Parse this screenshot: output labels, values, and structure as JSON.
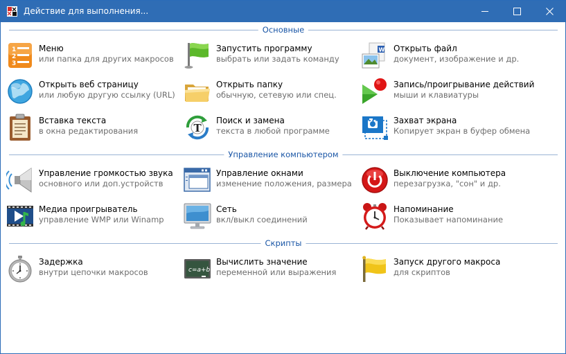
{
  "window": {
    "title": "Действие для выполнения..."
  },
  "colors": {
    "titlebar": "#2f6db5",
    "section_text": "#1a56a6",
    "section_line": "#9ab3d5",
    "subtitle_text": "#6d6d6d"
  },
  "sections": {
    "basic": {
      "label": "Основные",
      "items": [
        {
          "icon": "menu-list-icon",
          "title": "Меню",
          "subtitle": "или папка для других макросов"
        },
        {
          "icon": "green-flag-icon",
          "title": "Запустить программу",
          "subtitle": "выбрать или задать команду"
        },
        {
          "icon": "open-file-icon",
          "title": "Открыть файл",
          "subtitle": "документ, изображение и др."
        },
        {
          "icon": "globe-icon",
          "title": "Открыть веб страницу",
          "subtitle": "или любую другую ссылку (URL)"
        },
        {
          "icon": "folder-icon",
          "title": "Открыть папку",
          "subtitle": "обычную, сетевую или спец."
        },
        {
          "icon": "record-play-icon",
          "title": "Запись/проигрывание действий",
          "subtitle": "мыши и клавиатуры"
        },
        {
          "icon": "clipboard-icon",
          "title": "Вставка текста",
          "subtitle": "в окна редактирования"
        },
        {
          "icon": "find-replace-icon",
          "title": "Поиск и замена",
          "subtitle": "текста в любой программе"
        },
        {
          "icon": "screen-capture-icon",
          "title": "Захват экрана",
          "subtitle": "Копирует экран в буфер обмена"
        }
      ]
    },
    "computer": {
      "label": "Управление компьютером",
      "items": [
        {
          "icon": "speaker-icon",
          "title": "Управление громкостью звука",
          "subtitle": "основного или доп.устройств"
        },
        {
          "icon": "window-manage-icon",
          "title": "Управление окнами",
          "subtitle": "изменение положения, размера"
        },
        {
          "icon": "power-icon",
          "title": "Выключение компьютера",
          "subtitle": "перезагрузка, \"сон\" и др."
        },
        {
          "icon": "media-player-icon",
          "title": "Медиа проигрыватель",
          "subtitle": "управление WMP или Winamp"
        },
        {
          "icon": "monitor-network-icon",
          "title": "Сеть",
          "subtitle": "вкл/выкл соединений"
        },
        {
          "icon": "alarm-clock-icon",
          "title": "Напоминание",
          "subtitle": "Показывает напоминание"
        }
      ]
    },
    "scripts": {
      "label": "Скрипты",
      "items": [
        {
          "icon": "stopwatch-icon",
          "title": "Задержка",
          "subtitle": "внутри цепочки макросов"
        },
        {
          "icon": "chalkboard-icon",
          "title": "Вычислить значение",
          "subtitle": "переменной или выражения",
          "board_text": "c=a+b"
        },
        {
          "icon": "yellow-flag-icon",
          "title": "Запуск другого макроса",
          "subtitle": "для скриптов"
        }
      ]
    }
  }
}
